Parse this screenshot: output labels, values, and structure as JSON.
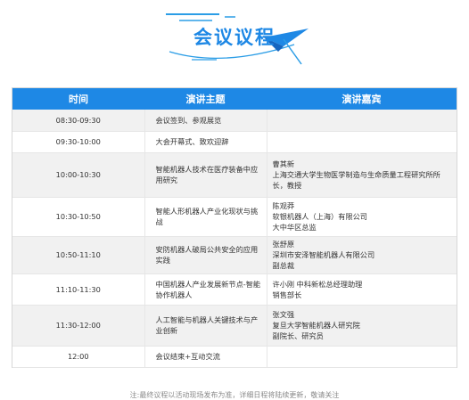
{
  "page_title": "会议议程",
  "colors": {
    "accent": "#1e88e5",
    "header_bg": "#1e88e5",
    "row_odd": "#f1f1f1",
    "row_even": "#ffffff",
    "decoration": "#2b9de6"
  },
  "table": {
    "headers": {
      "time": "时间",
      "topic": "演讲主题",
      "speaker": "演讲嘉宾"
    },
    "rows": [
      {
        "time": "08:30-09:30",
        "topic": "会议签到、参观展览",
        "speaker": []
      },
      {
        "time": "09:30-10:00",
        "topic": "大会开幕式、致欢迎辞",
        "speaker": []
      },
      {
        "time": "10:00-10:30",
        "topic": "智能机器人技术在医疗装备中应用研究",
        "speaker": [
          "曹其新",
          "上海交通大学生物医学制造与生命质量工程研究所所长，教授"
        ]
      },
      {
        "time": "10:30-10:50",
        "topic": "智能人形机器人产业化现状与挑战",
        "speaker": [
          "陈观莽",
          "软银机器人（上海）有限公司",
          "大中华区总监"
        ]
      },
      {
        "time": "10:50-11:10",
        "topic": "安防机器人破局公共安全的应用实践",
        "speaker": [
          "张舒原",
          "深圳市安泽智能机器人有限公司",
          "副总裁"
        ]
      },
      {
        "time": "11:10-11:30",
        "topic": "中国机器人产业发展新节点-智能协作机器人",
        "speaker": [
          "许小刚 中科新松总经理助理",
          "销售部长"
        ]
      },
      {
        "time": "11:30-12:00",
        "topic": "人工智能与机器人关键技术与产业创新",
        "speaker": [
          "张文强",
          "复旦大学智能机器人研究院",
          "副院长、研究员"
        ]
      },
      {
        "time": "12:00",
        "topic": "会议结束+互动交流",
        "speaker": []
      }
    ]
  },
  "footer": "注:最终议程以活动现场发布为准，详细日程将陆续更新，敬请关注"
}
